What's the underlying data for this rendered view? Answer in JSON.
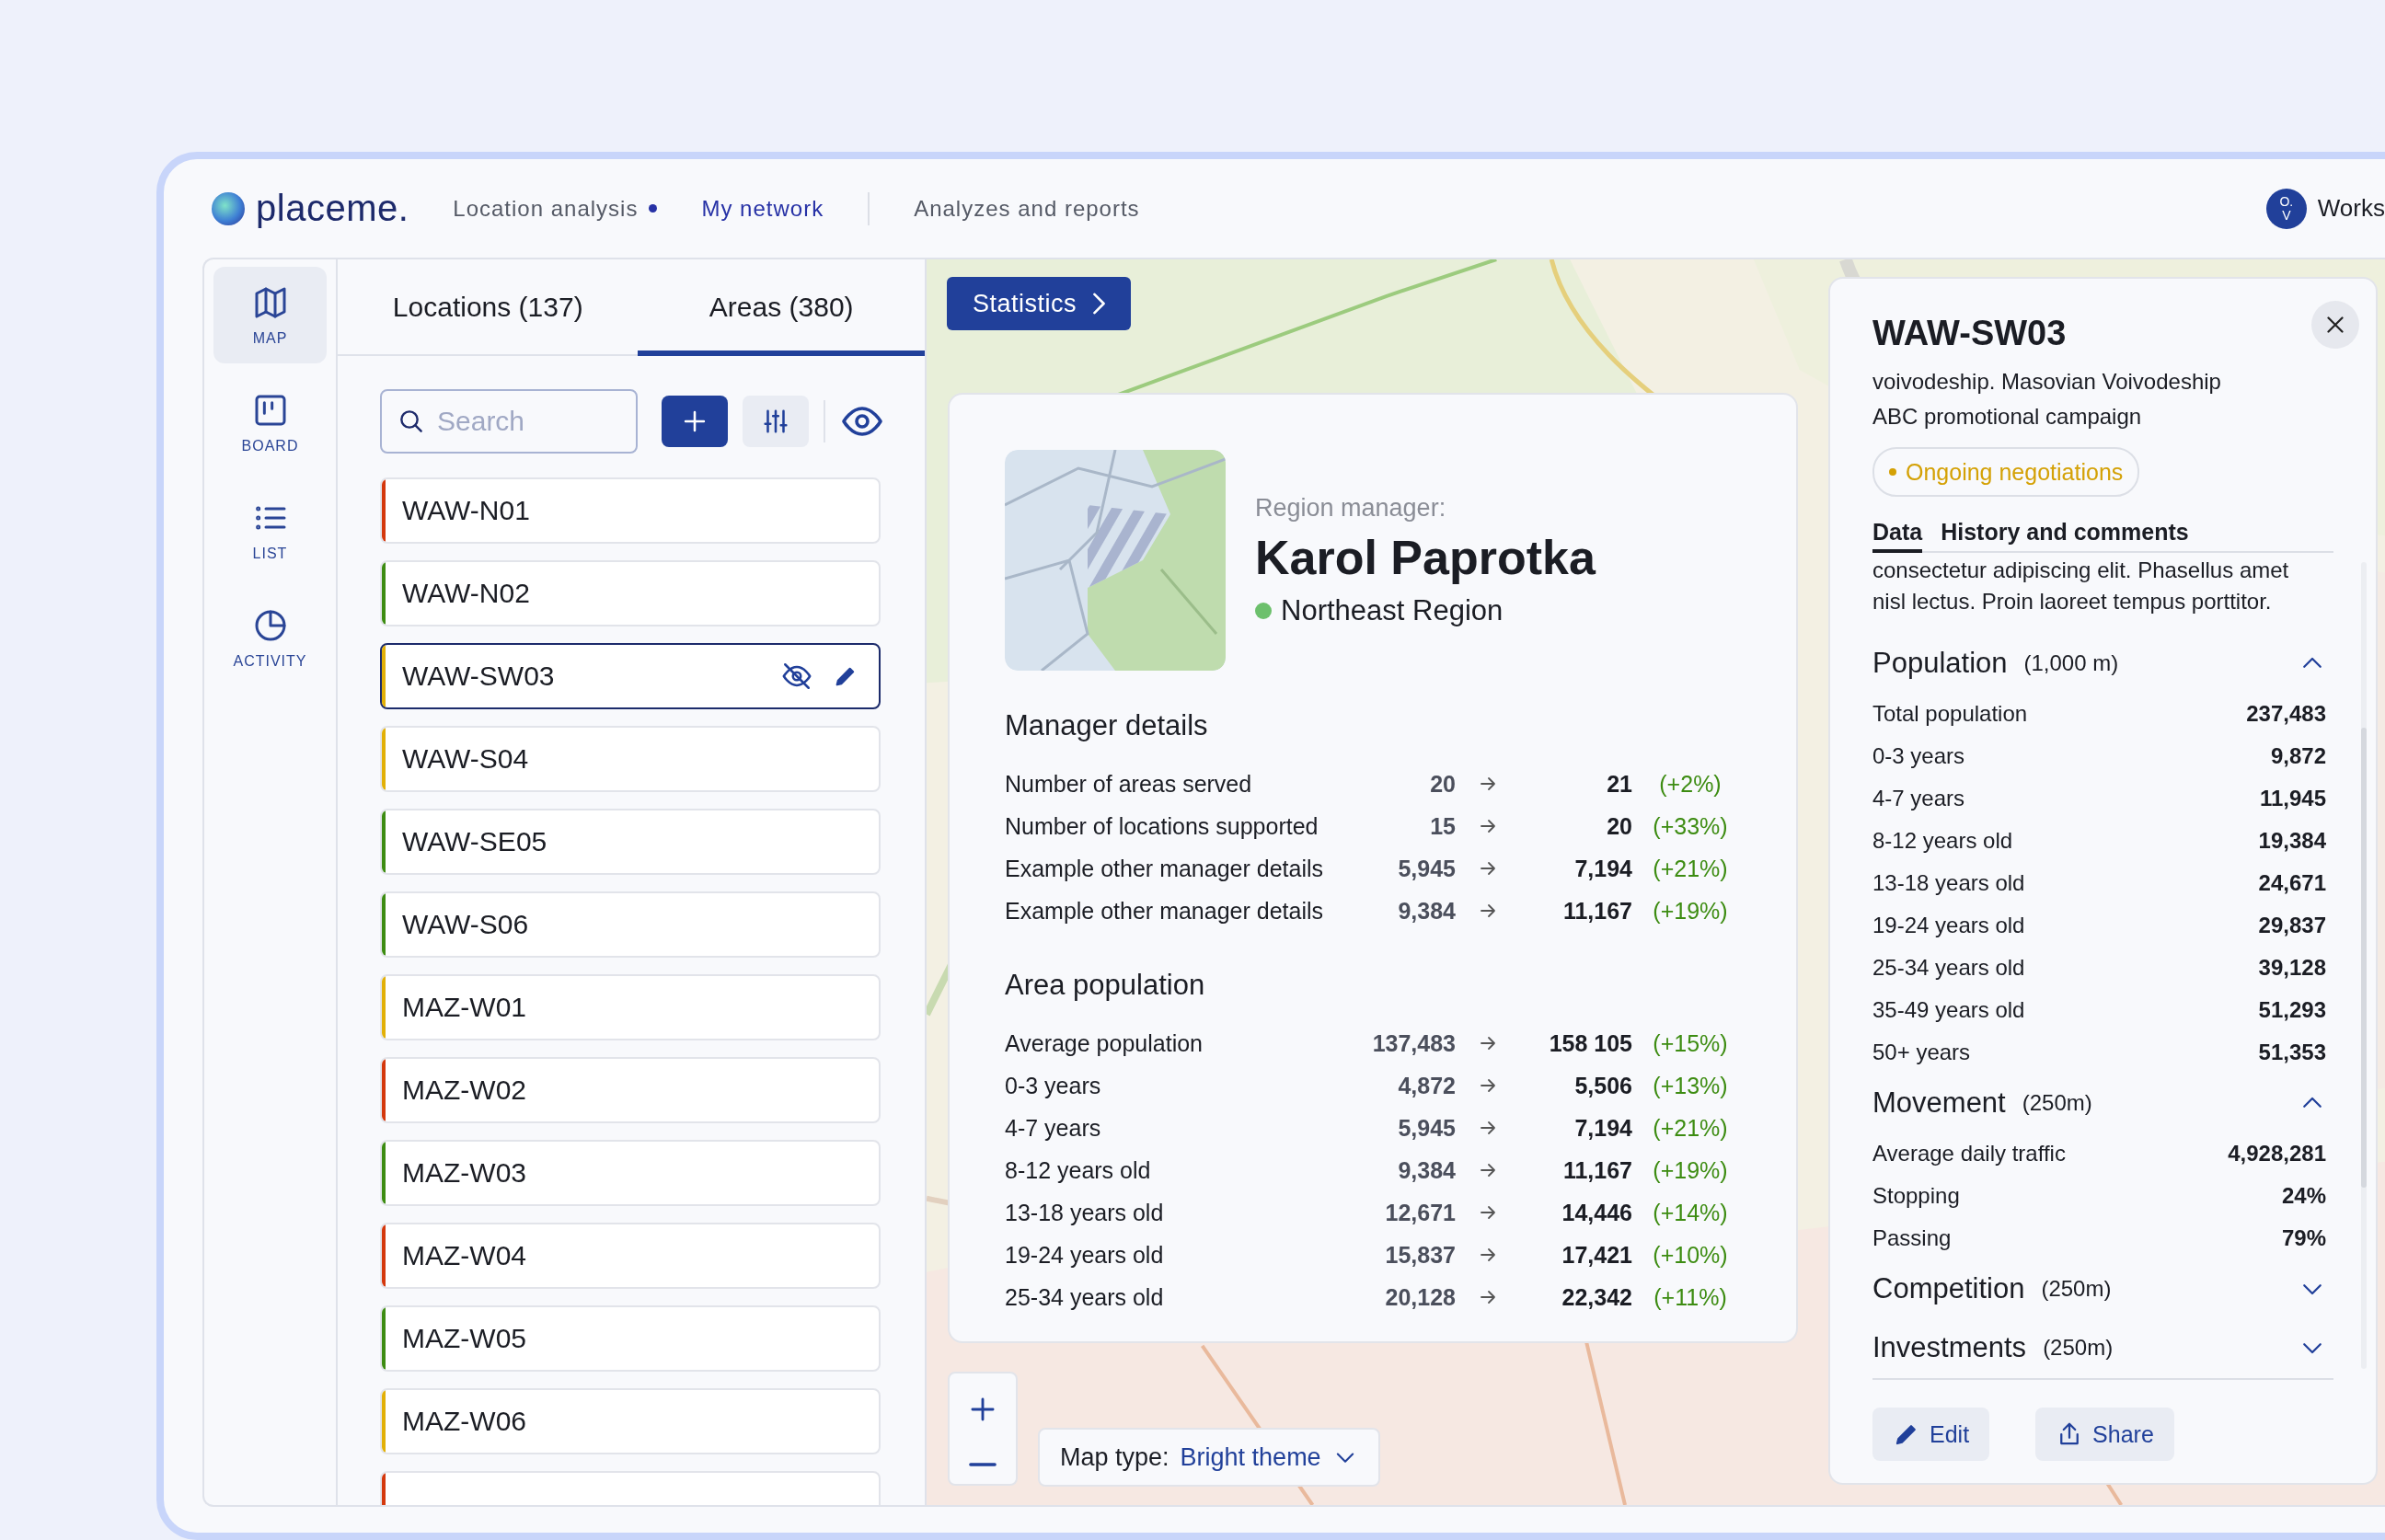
{
  "header": {
    "logo": "placeme.",
    "nav": [
      {
        "label": "Location analysis",
        "selected": false,
        "badge": true
      },
      {
        "label": "My network",
        "selected": true,
        "badge": false
      },
      {
        "label": "Analyzes and reports",
        "selected": false,
        "badge": false
      }
    ],
    "avatar_initials": "O. V",
    "workspace": "Works"
  },
  "sidebar": [
    {
      "label": "MAP",
      "selected": true
    },
    {
      "label": "BOARD",
      "selected": false
    },
    {
      "label": "LIST",
      "selected": false
    },
    {
      "label": "ACTIVITY",
      "selected": false
    }
  ],
  "tabs": [
    {
      "label": "Locations (137)",
      "selected": false
    },
    {
      "label": "Areas (380)",
      "selected": true
    }
  ],
  "search": {
    "placeholder": "Search"
  },
  "areas": [
    {
      "name": "WAW-N01",
      "color": "#d4380d",
      "selected": false
    },
    {
      "name": "WAW-N02",
      "color": "#3d8c12",
      "selected": false
    },
    {
      "name": "WAW-SW03",
      "color": "#e2b007",
      "selected": true
    },
    {
      "name": "WAW-S04",
      "color": "#e2b007",
      "selected": false
    },
    {
      "name": "WAW-SE05",
      "color": "#3d8c12",
      "selected": false
    },
    {
      "name": "WAW-S06",
      "color": "#3d8c12",
      "selected": false
    },
    {
      "name": "MAZ-W01",
      "color": "#e2b007",
      "selected": false
    },
    {
      "name": "MAZ-W02",
      "color": "#d4380d",
      "selected": false
    },
    {
      "name": "MAZ-W03",
      "color": "#3d8c12",
      "selected": false
    },
    {
      "name": "MAZ-W04",
      "color": "#d4380d",
      "selected": false
    },
    {
      "name": "MAZ-W05",
      "color": "#3d8c12",
      "selected": false
    },
    {
      "name": "MAZ-W06",
      "color": "#e2b007",
      "selected": false
    },
    {
      "color": "#d4380d",
      "selected": false
    }
  ],
  "map": {
    "statistics_button": "Statistics",
    "map_type_label": "Map type:",
    "map_type_value": "Bright theme"
  },
  "manager_card": {
    "label": "Region manager:",
    "name": "Karol Paprotka",
    "region": {
      "name": "Northeast Region",
      "color": "#6cc06c"
    },
    "sections": [
      {
        "title": "Manager details",
        "rows": [
          {
            "label": "Number of areas served",
            "from": "20",
            "to": "21",
            "change": "(+2%)"
          },
          {
            "label": "Number of locations supported",
            "from": "15",
            "to": "20",
            "change": "(+33%)"
          },
          {
            "label": "Example other manager details",
            "from": "5,945",
            "to": "7,194",
            "change": "(+21%)"
          },
          {
            "label": "Example other manager details",
            "from": "9,384",
            "to": "11,167",
            "change": "(+19%)"
          }
        ]
      },
      {
        "title": "Area population",
        "rows": [
          {
            "label": "Average population",
            "from": "137,483",
            "to": "158 105",
            "change": "(+15%)"
          },
          {
            "label": "0-3 years",
            "from": "4,872",
            "to": "5,506",
            "change": "(+13%)"
          },
          {
            "label": "4-7 years",
            "from": "5,945",
            "to": "7,194",
            "change": "(+21%)"
          },
          {
            "label": "8-12 years old",
            "from": "9,384",
            "to": "11,167",
            "change": "(+19%)"
          },
          {
            "label": "13-18 years old",
            "from": "12,671",
            "to": "14,446",
            "change": "(+14%)"
          },
          {
            "label": "19-24 years old",
            "from": "15,837",
            "to": "17,421",
            "change": "(+10%)"
          },
          {
            "label": "25-34 years old",
            "from": "20,128",
            "to": "22,342",
            "change": "(+11%)"
          }
        ]
      }
    ]
  },
  "detail": {
    "title": "WAW-SW03",
    "lines": [
      "voivodeship. Masovian Voivodeship",
      "ABC promotional campaign"
    ],
    "status": {
      "label": "Ongoing negotiations",
      "color": "#d4a106"
    },
    "tabs": [
      {
        "label": "Data",
        "selected": true
      },
      {
        "label": "History and comments",
        "selected": false
      }
    ],
    "note": "consectetur adipiscing elit. Phasellus amet nisl lectus. Proin laoreet tempus porttitor.",
    "sections": [
      {
        "title": "Population",
        "radius": "(1,000 m)",
        "expanded": true,
        "rows": [
          {
            "label": "Total population",
            "value": "237,483"
          },
          {
            "label": "0-3 years",
            "value": "9,872"
          },
          {
            "label": "4-7 years",
            "value": "11,945"
          },
          {
            "label": "8-12 years old",
            "value": "19,384"
          },
          {
            "label": "13-18 years old",
            "value": "24,671"
          },
          {
            "label": "19-24 years old",
            "value": "29,837"
          },
          {
            "label": "25-34 years old",
            "value": "39,128"
          },
          {
            "label": "35-49 years old",
            "value": "51,293"
          },
          {
            "label": "50+ years",
            "value": "51,353"
          }
        ]
      },
      {
        "title": "Movement",
        "radius": "(250m)",
        "expanded": true,
        "rows": [
          {
            "label": "Average daily traffic",
            "value": "4,928,281"
          },
          {
            "label": "Stopping",
            "value": "24%"
          },
          {
            "label": "Passing",
            "value": "79%"
          }
        ]
      },
      {
        "title": "Competition",
        "radius": "(250m)",
        "expanded": false
      },
      {
        "title": "Investments",
        "radius": "(250m)",
        "expanded": false
      }
    ],
    "buttons": [
      "Edit",
      "Share"
    ]
  }
}
